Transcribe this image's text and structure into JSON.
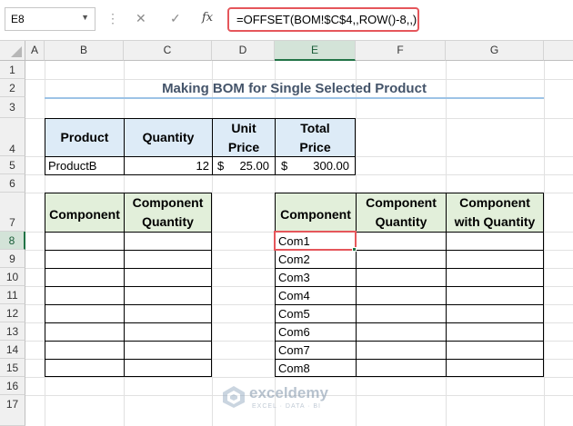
{
  "formula_bar": {
    "name_box": "E8",
    "formula": "=OFFSET(BOM!$C$4,,ROW()-8,,)",
    "cancel_icon": "✕",
    "enter_icon": "✓",
    "fx_label": "fx"
  },
  "columns": [
    "A",
    "B",
    "C",
    "D",
    "E",
    "F",
    "G"
  ],
  "rows": [
    "1",
    "2",
    "3",
    "4",
    "5",
    "6",
    "7",
    "8",
    "9",
    "10",
    "11",
    "12",
    "13",
    "14",
    "15",
    "16",
    "17"
  ],
  "selected_cell": "E8",
  "title": "Making BOM for Single Selected Product",
  "product_table": {
    "headers": [
      "Product",
      "Quantity",
      "Unit Price",
      "Total Price"
    ],
    "product": "ProductB",
    "quantity": "12",
    "currency": "$",
    "unit_price": "25.00",
    "total_price": "300.00"
  },
  "left_table": {
    "headers": [
      "Component",
      "Component Quantity"
    ]
  },
  "right_table": {
    "headers": [
      "Component",
      "Component Quantity",
      "Component with Quantity"
    ],
    "components": [
      "Com1",
      "Com2",
      "Com3",
      "Com4",
      "Com5",
      "Com6",
      "Com7",
      "Com8"
    ]
  },
  "watermark": {
    "brand": "exceldemy",
    "tagline": "EXCEL · DATA · BI"
  },
  "colors": {
    "header_blue": "#ddebf7",
    "header_green": "#e2efda",
    "title_text": "#44546a",
    "selection": "#e5565b",
    "excel_green": "#217346"
  }
}
